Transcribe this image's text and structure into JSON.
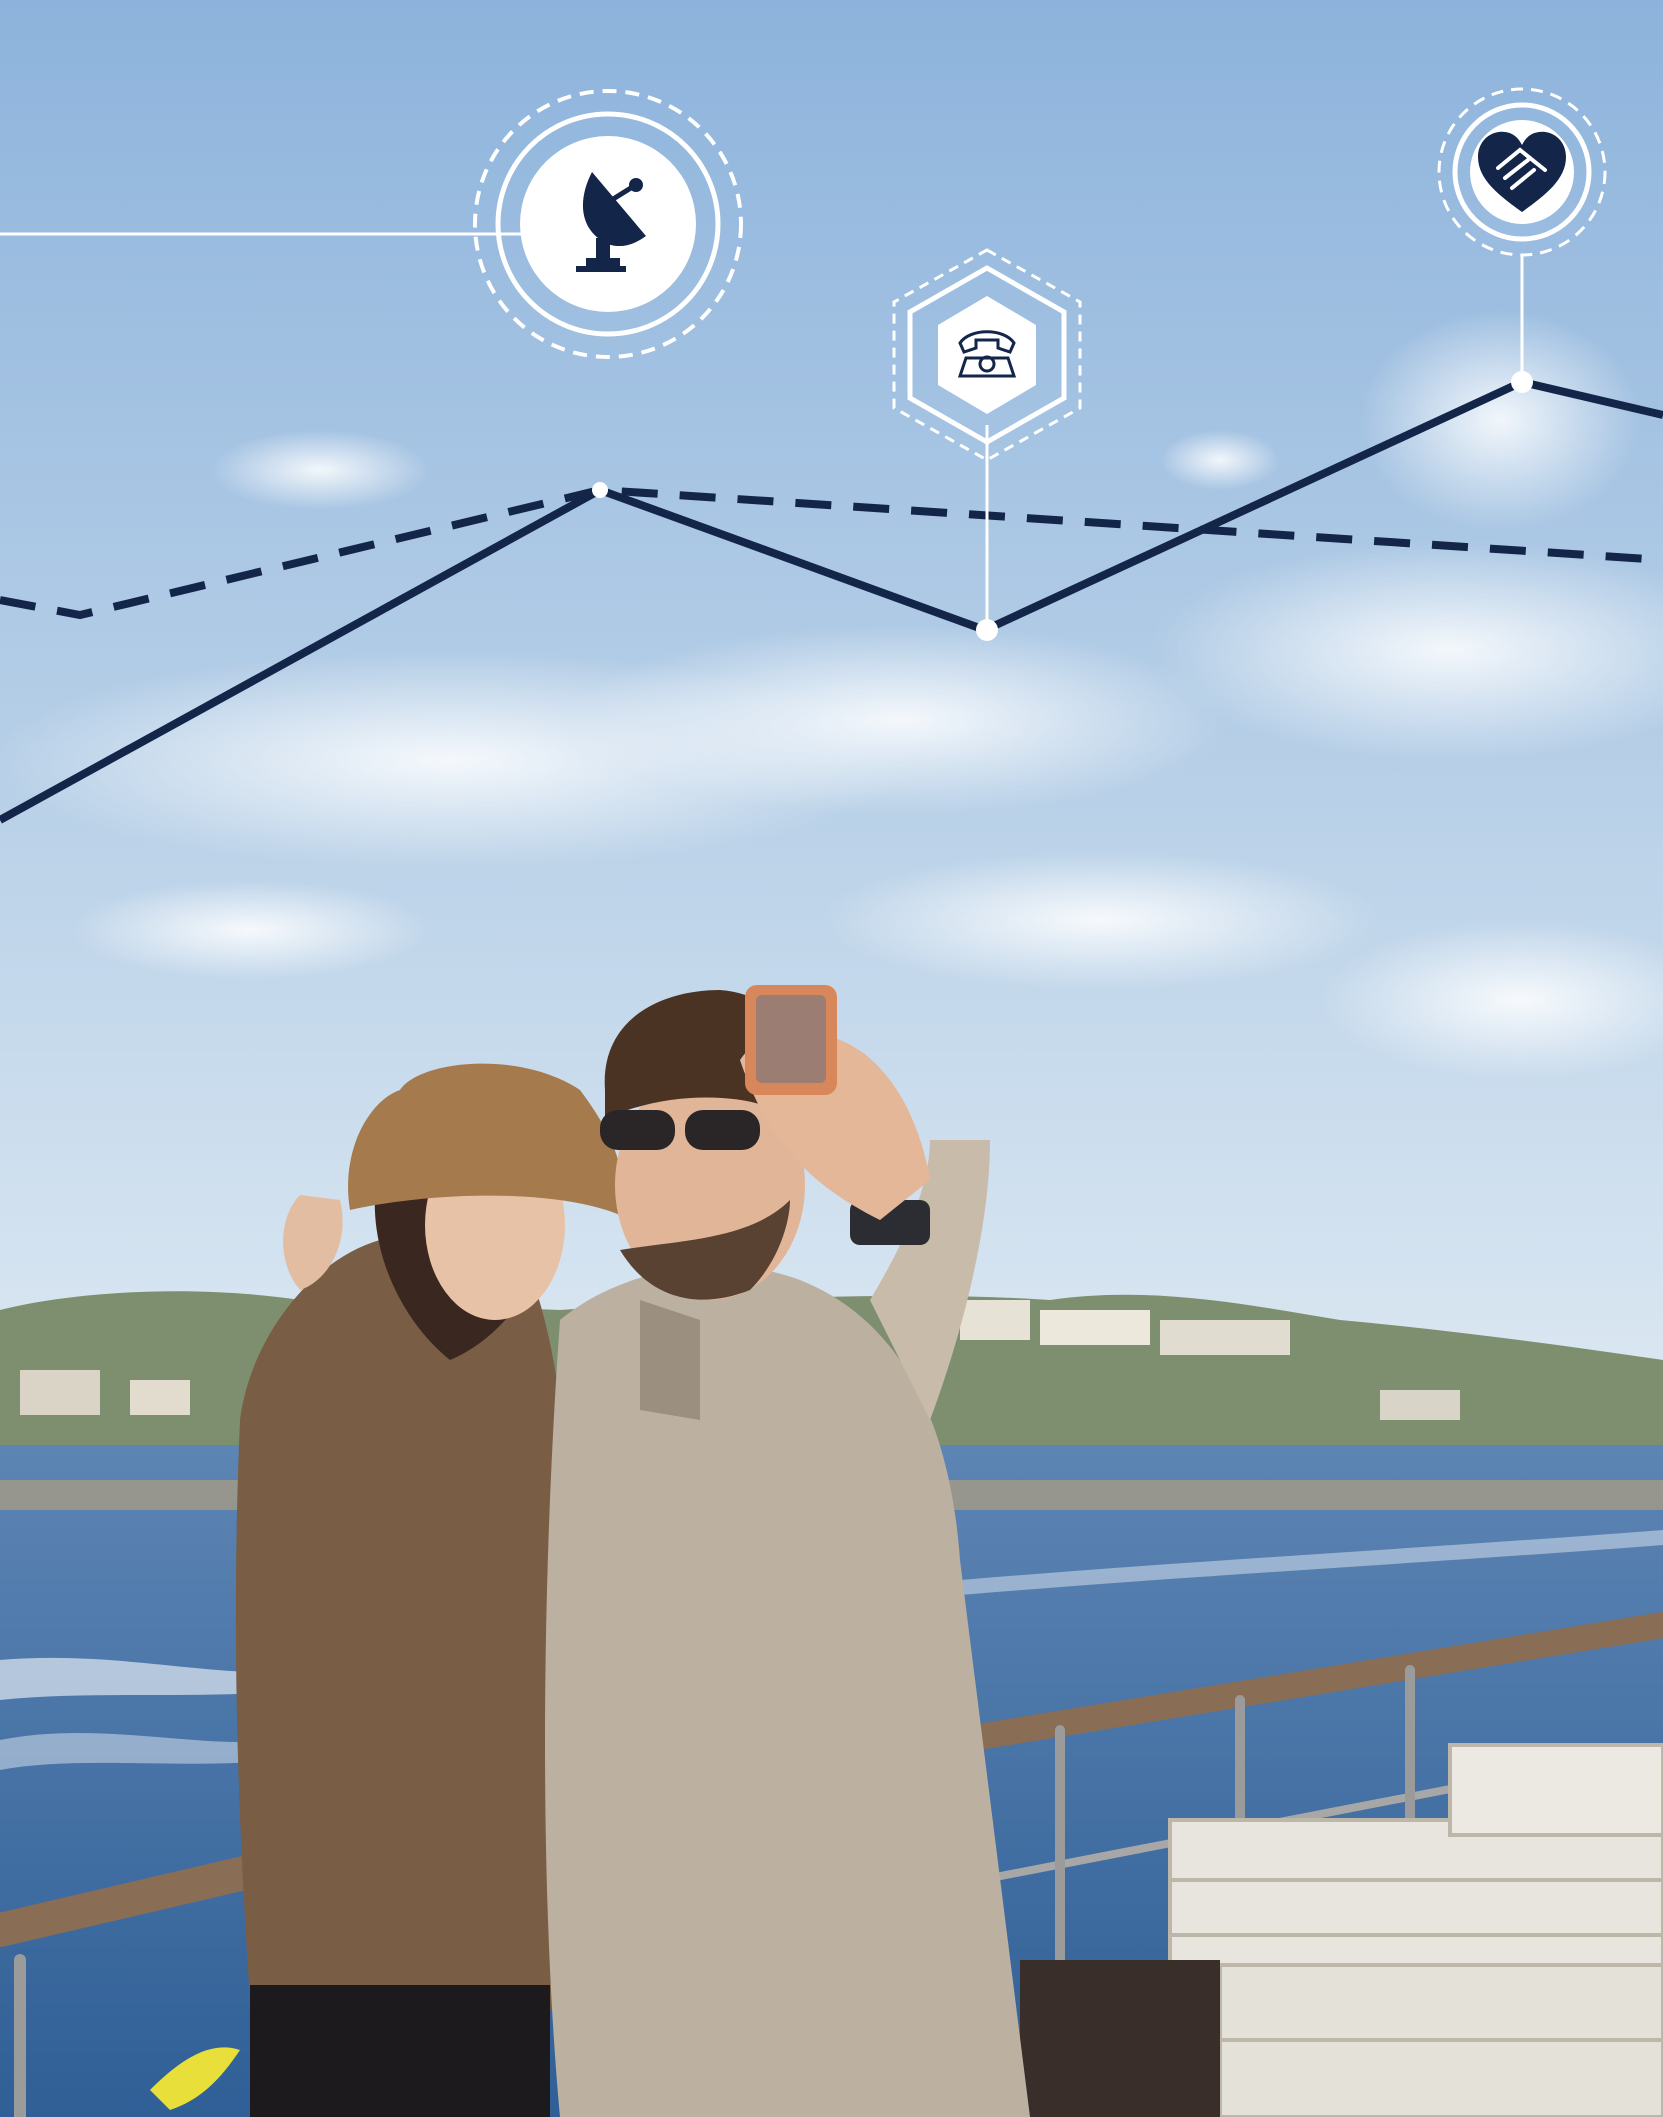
{
  "scene": {
    "description_icons": [
      "satellite-dish-icon",
      "telephone-icon",
      "heart-handshake-icon"
    ],
    "colors": {
      "navy": "#13264a",
      "sky_top": "#8fb5dd",
      "sky_bottom": "#dbe8f3",
      "sea": "#3f6fa6",
      "white": "#ffffff"
    }
  }
}
